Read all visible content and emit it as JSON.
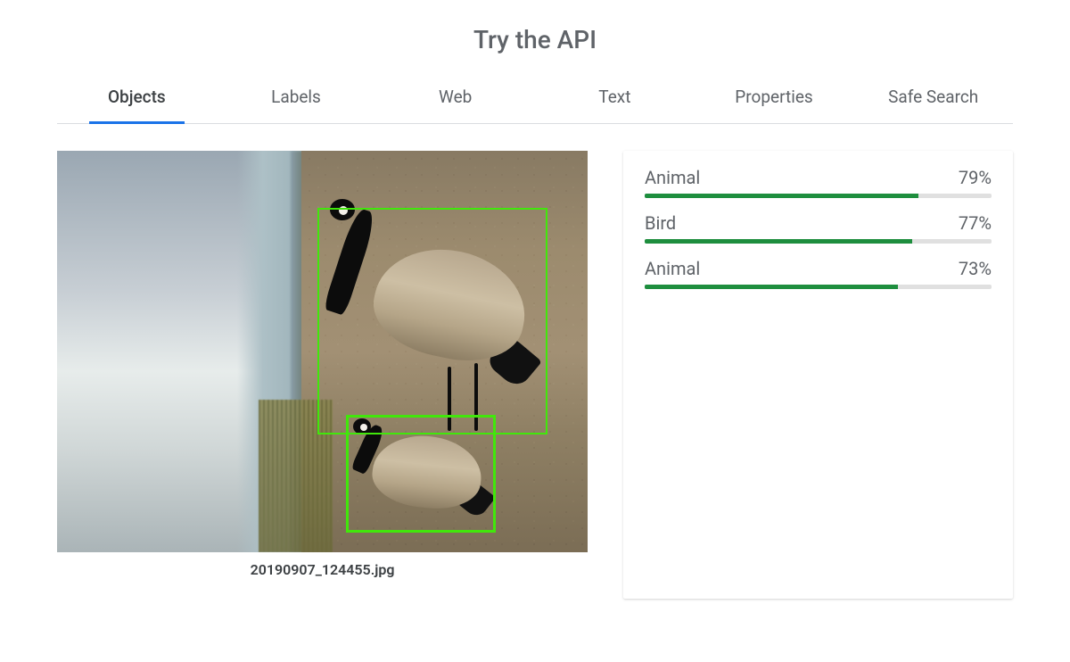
{
  "title": "Try the API",
  "tabs": [
    {
      "label": "Objects",
      "active": true
    },
    {
      "label": "Labels",
      "active": false
    },
    {
      "label": "Web",
      "active": false
    },
    {
      "label": "Text",
      "active": false
    },
    {
      "label": "Properties",
      "active": false
    },
    {
      "label": "Safe Search",
      "active": false
    }
  ],
  "filename": "20190907_124455.jpg",
  "results": [
    {
      "label": "Animal",
      "score_text": "79%",
      "score": 79
    },
    {
      "label": "Bird",
      "score_text": "77%",
      "score": 77
    },
    {
      "label": "Animal",
      "score_text": "73%",
      "score": 73
    }
  ]
}
